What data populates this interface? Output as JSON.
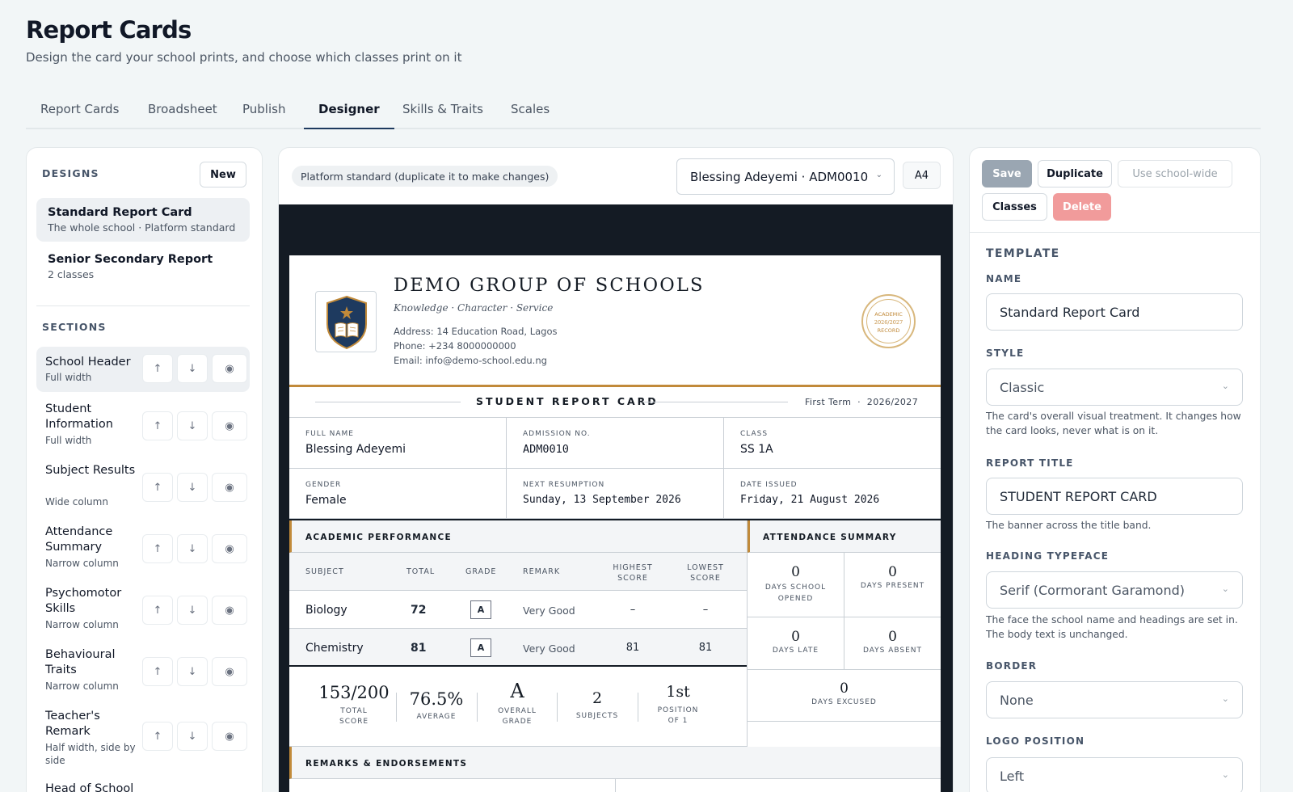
{
  "page": {
    "title": "Report Cards",
    "subtitle": "Design the card your school prints, and choose which classes print on it"
  },
  "tabs": [
    "Report Cards",
    "Broadsheet",
    "Publish",
    "Designer",
    "Skills & Traits",
    "Scales"
  ],
  "active_tab": "Designer",
  "designs": {
    "heading": "DESIGNS",
    "new_label": "New",
    "items": [
      {
        "name": "Standard Report Card",
        "meta": "The whole school · Platform standard"
      },
      {
        "name": "Senior Secondary Report",
        "meta": "2 classes"
      }
    ]
  },
  "sections": {
    "heading": "SECTIONS",
    "items": [
      {
        "name": "School Header",
        "meta": "Full width"
      },
      {
        "name": "Student Information",
        "meta": "Full width"
      },
      {
        "name": "Subject Results",
        "meta": "Wide column"
      },
      {
        "name": "Attendance Summary",
        "meta": "Narrow column"
      },
      {
        "name": "Psychomotor Skills",
        "meta": "Narrow column"
      },
      {
        "name": "Behavioural Traits",
        "meta": "Narrow column"
      },
      {
        "name": "Teacher's Remark",
        "meta": "Half width, side by side"
      },
      {
        "name": "Head of School",
        "meta": ""
      }
    ]
  },
  "preview": {
    "badge": "Platform standard (duplicate it to make changes)",
    "student_select": "Blessing Adeyemi · ADM0010",
    "paper": "A4"
  },
  "card": {
    "school_name": "DEMO GROUP OF SCHOOLS",
    "motto": "Knowledge · Character · Service",
    "address": "Address: 14 Education Road, Lagos",
    "phone": "Phone: +234 8000000000",
    "email": "Email: info@demo-school.edu.ng",
    "seal": [
      "ACADEMIC",
      "2026/2027",
      "RECORD"
    ],
    "report_title": "STUDENT REPORT CARD",
    "term": "First Term",
    "session": "2026/2027",
    "info": [
      {
        "label": "FULL NAME",
        "value": "Blessing Adeyemi"
      },
      {
        "label": "ADMISSION NO.",
        "value": "ADM0010"
      },
      {
        "label": "CLASS",
        "value": "SS 1A"
      },
      {
        "label": "GENDER",
        "value": "Female"
      },
      {
        "label": "NEXT RESUMPTION",
        "value": "Sunday, 13 September 2026"
      },
      {
        "label": "DATE ISSUED",
        "value": "Friday, 21 August 2026"
      }
    ],
    "academic": {
      "heading": "ACADEMIC PERFORMANCE",
      "cols": [
        "SUBJECT",
        "TOTAL",
        "GRADE",
        "REMARK",
        "HIGHEST",
        "SCORE",
        "LOWEST",
        "SCORE"
      ],
      "rows": [
        {
          "subject": "Biology",
          "total": "72",
          "grade": "A",
          "remark": "Very Good",
          "high": "–",
          "low": "–"
        },
        {
          "subject": "Chemistry",
          "total": "81",
          "grade": "A",
          "remark": "Very Good",
          "high": "81",
          "low": "81"
        }
      ]
    },
    "summary": [
      {
        "value": "153/200",
        "label": [
          "TOTAL",
          "SCORE"
        ]
      },
      {
        "value": "76.5%",
        "label": [
          "AVERAGE"
        ]
      },
      {
        "value": "A",
        "label": [
          "OVERALL",
          "GRADE"
        ]
      },
      {
        "value": "2",
        "label": [
          "SUBJECTS"
        ]
      },
      {
        "value": "1st",
        "label": [
          "POSITION",
          "OF 1"
        ]
      }
    ],
    "attendance": {
      "heading": "ATTENDANCE SUMMARY",
      "items": [
        {
          "value": "0",
          "label": [
            "DAYS SCHOOL",
            "OPENED"
          ]
        },
        {
          "value": "0",
          "label": [
            "DAYS PRESENT"
          ]
        },
        {
          "value": "0",
          "label": [
            "DAYS LATE"
          ]
        },
        {
          "value": "0",
          "label": [
            "DAYS ABSENT"
          ]
        },
        {
          "value": "0",
          "label": [
            "DAYS EXCUSED"
          ]
        }
      ]
    },
    "remarks_heading": "REMARKS & ENDORSEMENTS"
  },
  "actions": {
    "save": "Save",
    "duplicate": "Duplicate",
    "school_wide": "Use school-wide",
    "classes": "Classes",
    "delete": "Delete"
  },
  "template": {
    "heading": "TEMPLATE",
    "name_label": "NAME",
    "name_value": "Standard Report Card",
    "style_label": "STYLE",
    "style_value": "Classic",
    "style_help": "The card's overall visual treatment. It changes how the card looks, never what is on it.",
    "title_label": "REPORT TITLE",
    "title_value": "STUDENT REPORT CARD",
    "title_help": "The banner across the title band.",
    "typeface_label": "HEADING TYPEFACE",
    "typeface_value": "Serif (Cormorant Garamond)",
    "typeface_help": "The face the school name and headings are set in. The body text is unchanged.",
    "border_label": "BORDER",
    "border_value": "None",
    "logo_label": "LOGO POSITION",
    "logo_value": "Left"
  },
  "colors": {
    "accent": "#c18a3a",
    "navy": "#1e3a5f",
    "dark": "#141b24",
    "delete": "#f19b9b",
    "save": "#9aa6b2"
  }
}
